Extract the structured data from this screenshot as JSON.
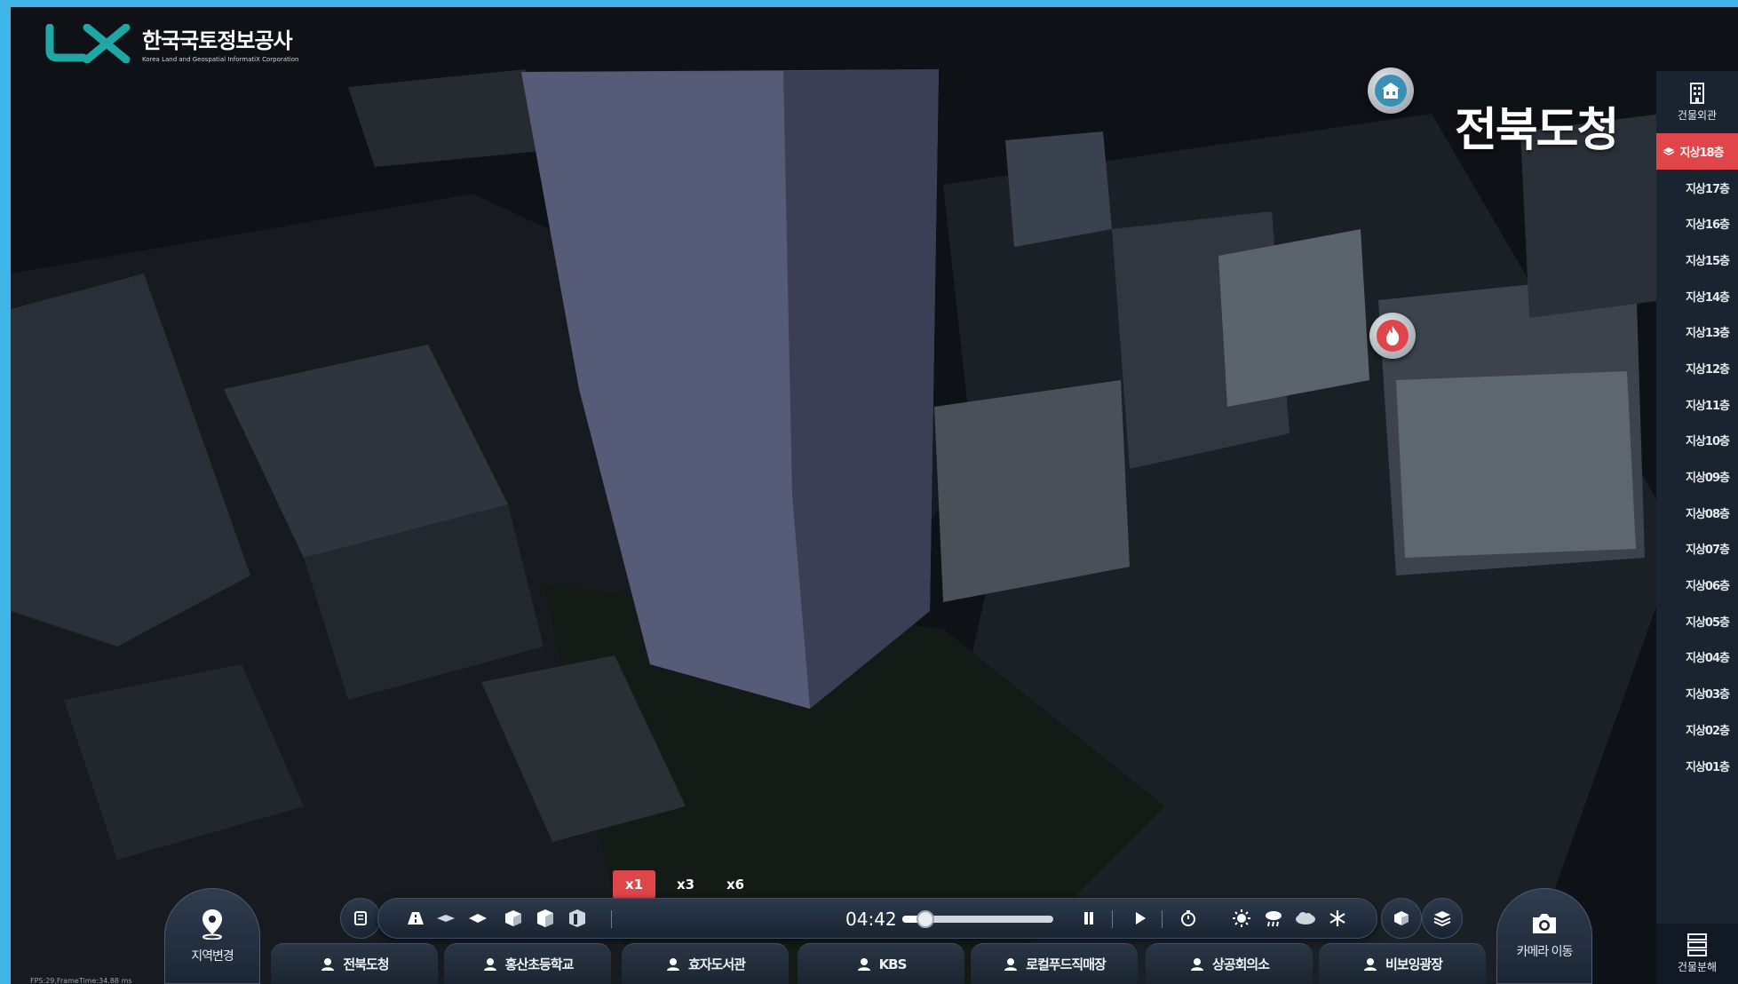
{
  "logo": {
    "title": "한국국토정보공사",
    "subtitle": "Korea Land and Geospatial InformatiX Corporation"
  },
  "building_title": "전북도청",
  "map_markers": [
    {
      "name": "building-marker",
      "icon": "building-icon",
      "color": "#3a8fb7"
    },
    {
      "name": "fire-marker",
      "icon": "fire-icon",
      "color": "#e0454a"
    }
  ],
  "floor_panel": {
    "header_label": "건물외관",
    "floors": [
      "지상18층",
      "지상17층",
      "지상16층",
      "지상15층",
      "지상14층",
      "지상13층",
      "지상12층",
      "지상11층",
      "지상10층",
      "지상09층",
      "지상08층",
      "지상07층",
      "지상06층",
      "지상05층",
      "지상04층",
      "지상03층",
      "지상02층",
      "지상01층"
    ],
    "active_floor": "지상18층",
    "footer_label": "건물분해"
  },
  "speed_options": [
    "x1",
    "x3",
    "x6"
  ],
  "active_speed": "x1",
  "playback": {
    "time": "04:42",
    "progress": 0.15
  },
  "toolbar_icons": [
    "scroll-icon",
    "road-icon",
    "layer-flat-icon",
    "layer-plane-icon",
    "cube-icon",
    "cube-half-icon",
    "cube-cut-icon",
    "pause-icon",
    "play-icon",
    "timer-icon",
    "sun-icon",
    "rain-icon",
    "cloud-icon",
    "snow-icon",
    "box-icon",
    "stack-icon"
  ],
  "region_button": {
    "label": "지역변경",
    "icon": "location-pin-icon"
  },
  "camera_button": {
    "label": "카메라 이동",
    "icon": "camera-icon"
  },
  "locations": [
    "전북도청",
    "홍산초등학교",
    "효자도서관",
    "KBS",
    "로컬푸드직매장",
    "상공회의소",
    "비보잉광장"
  ],
  "fps_text": "FPS:29,FrameTime:34.88 ms",
  "colors": {
    "accent": "#e0454a",
    "panel": "#1a2431",
    "border": "#3fb6e8"
  }
}
